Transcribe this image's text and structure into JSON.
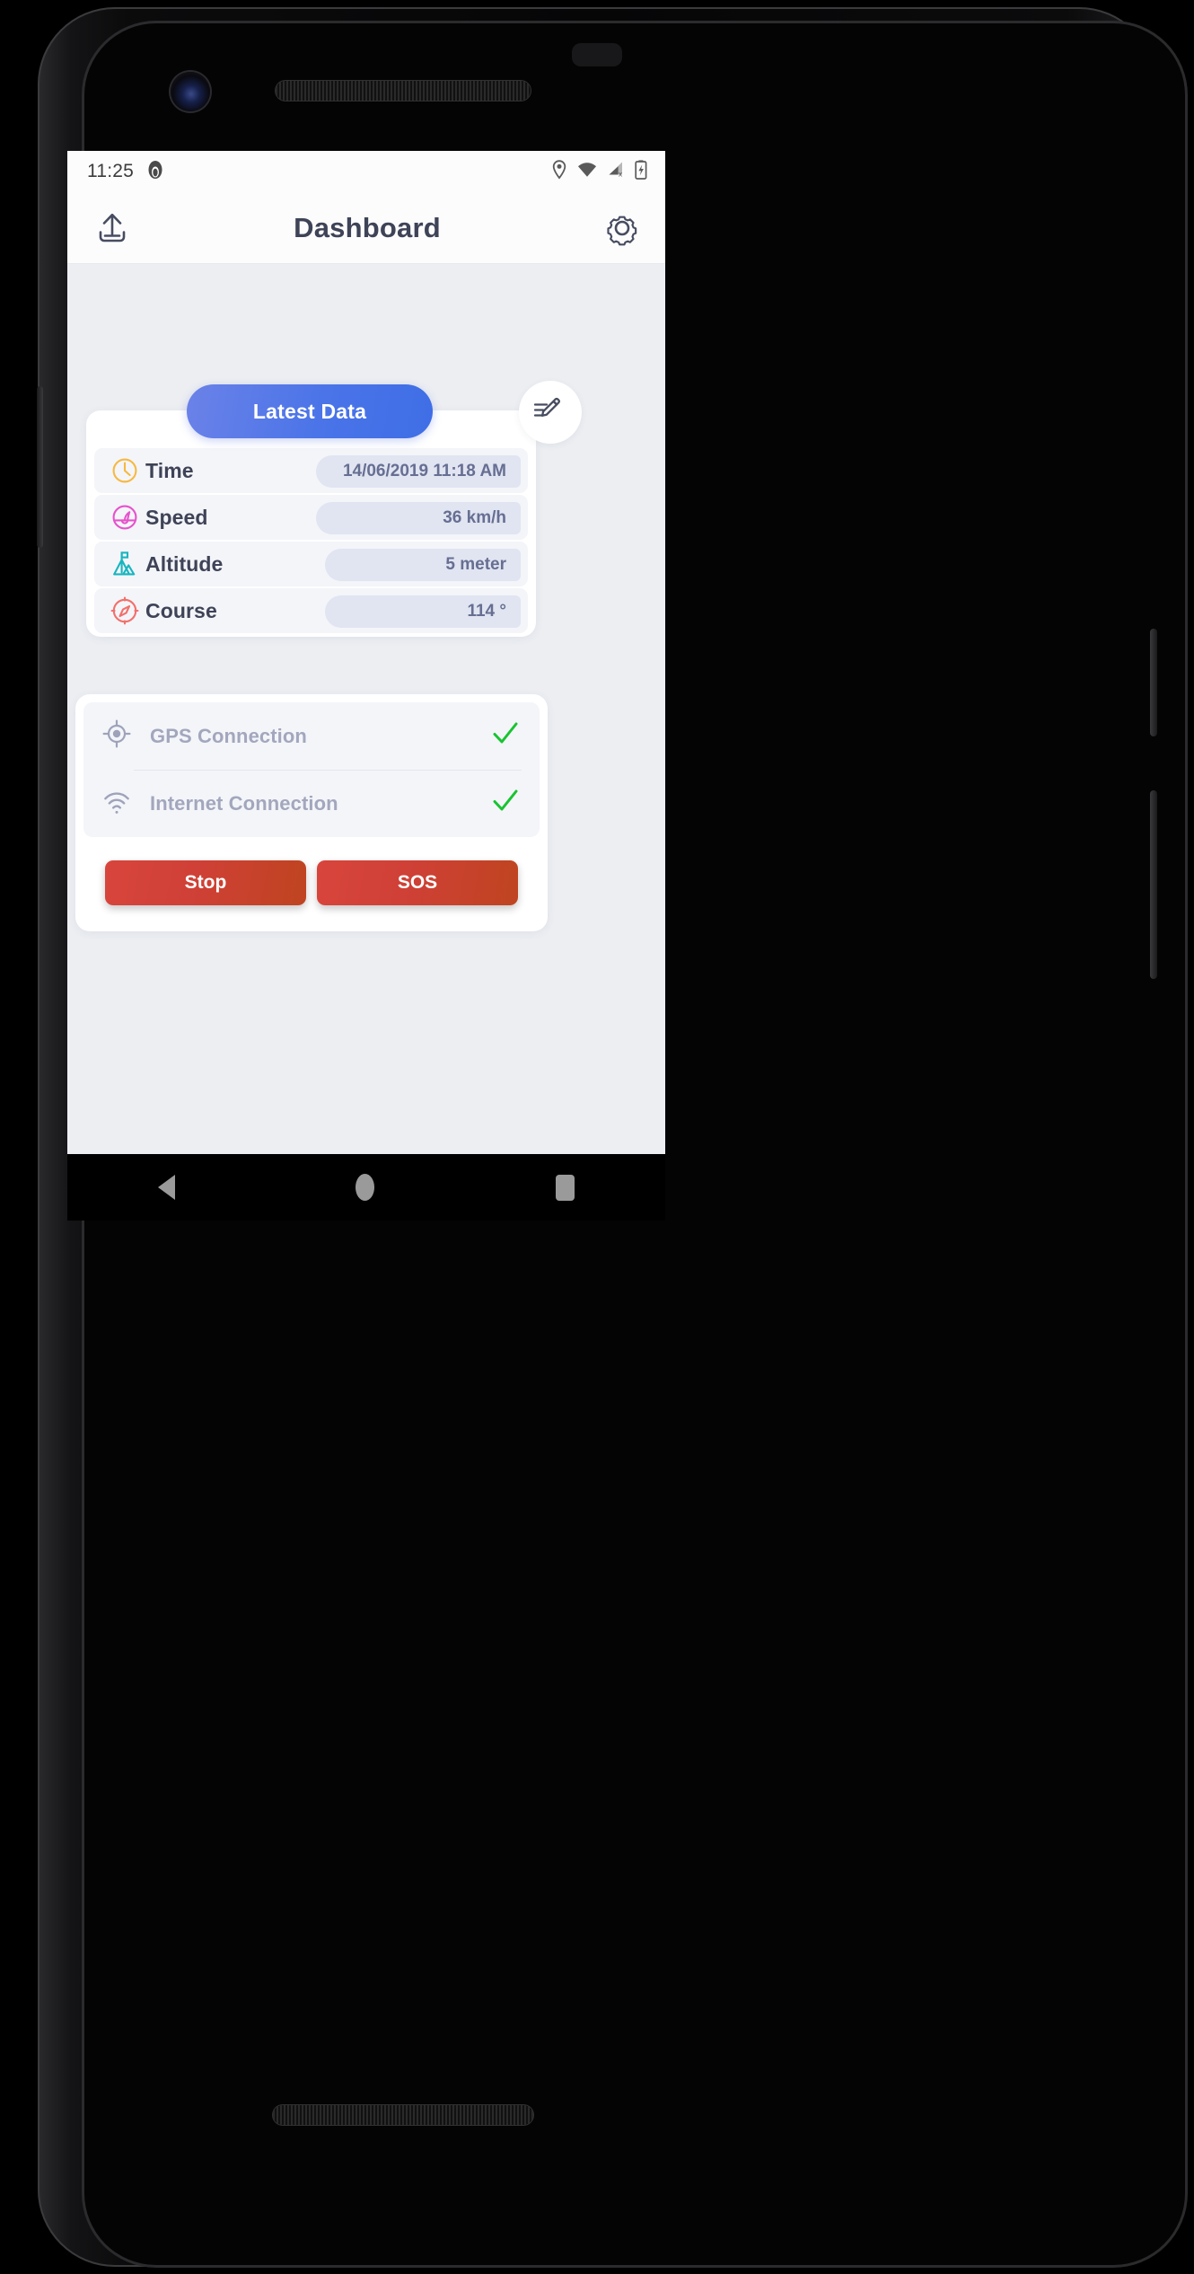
{
  "status_bar": {
    "time": "11:25",
    "left_icons": [
      "app-notification-icon"
    ],
    "right_icons": [
      "location-pin-icon",
      "wifi-icon",
      "cellular-no-sim-icon",
      "battery-charging-icon"
    ]
  },
  "app_bar": {
    "title": "Dashboard",
    "left_action": {
      "name": "upload-icon",
      "label": "Upload"
    },
    "right_action": {
      "name": "settings-gear-icon",
      "label": "Settings"
    }
  },
  "latest_data": {
    "tab_label": "Latest Data",
    "edit_button": {
      "name": "edit-pencil-icon",
      "label": "Edit"
    },
    "rows": [
      {
        "icon": "clock-icon",
        "label": "Time",
        "value": "14/06/2019 11:18 AM",
        "icon_color": "#f5b942"
      },
      {
        "icon": "speedometer-icon",
        "label": "Speed",
        "value": "36 km/h",
        "icon_color": "#e652cc"
      },
      {
        "icon": "mountain-flag-icon",
        "label": "Altitude",
        "value": "5 meter",
        "icon_color": "#18b5bf"
      },
      {
        "icon": "compass-icon",
        "label": "Course",
        "value": "114 °",
        "icon_color": "#f2706b"
      }
    ]
  },
  "connections": [
    {
      "icon": "gps-target-icon",
      "label": "GPS Connection",
      "status": "connected",
      "status_icon": "check-icon"
    },
    {
      "icon": "wifi-signal-icon",
      "label": "Internet Connection",
      "status": "connected",
      "status_icon": "check-icon"
    }
  ],
  "actions": {
    "stop_label": "Stop",
    "sos_label": "SOS"
  },
  "nav_bar": {
    "back": "back-triangle-icon",
    "home": "home-circle-icon",
    "recents": "recents-square-icon"
  },
  "colors": {
    "accent_blue": "#4a74e8",
    "danger_red": "#cf4036",
    "success_green": "#18c430",
    "background": "#eceef2",
    "text_dark": "#3e4357",
    "text_muted": "#a2a7bd",
    "pill_bg": "#e1e4f1"
  }
}
